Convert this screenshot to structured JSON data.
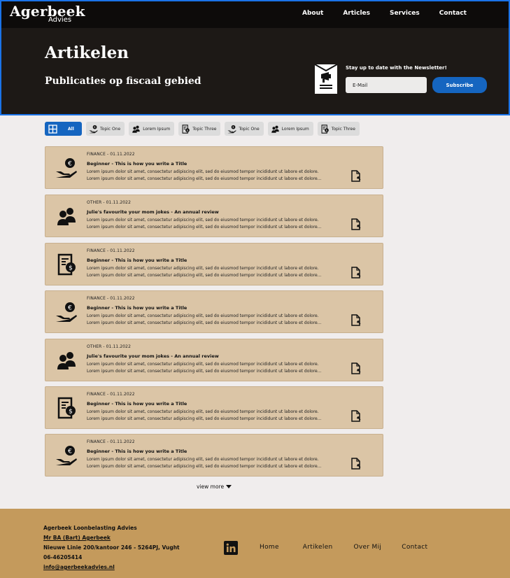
{
  "header": {
    "logo_main": "Agerbeek",
    "logo_sub": "Advies",
    "nav": [
      "About",
      "Articles",
      "Services",
      "Contact"
    ]
  },
  "hero": {
    "title": "Artikelen",
    "subtitle": "Publicaties op fiscaal gebied",
    "newsletter_label": "Stay up to date with the Newsletter!",
    "email_placeholder": "E-Mail",
    "subscribe_label": "Subscribe"
  },
  "filters": [
    {
      "label": "All",
      "icon": "grid-icon",
      "active": true
    },
    {
      "label": "Topic One",
      "icon": "coin-hand-icon",
      "active": false
    },
    {
      "label": "Lorem Ipsum",
      "icon": "people-icon",
      "active": false
    },
    {
      "label": "Topic Three",
      "icon": "invoice-icon",
      "active": false
    },
    {
      "label": "Topic One",
      "icon": "coin-hand-icon",
      "active": false
    },
    {
      "label": "Lorem Ipsum",
      "icon": "people-icon",
      "active": false
    },
    {
      "label": "Topic Three",
      "icon": "invoice-icon",
      "active": false
    }
  ],
  "articles": [
    {
      "meta": "FINANCE - 01.11.2022",
      "title": "Beginner - This is how you write a Title",
      "icon": "coin-hand-icon",
      "body1": "Lorem ipsum dolor sit amet, consectetur adipiscing elit, sed do eiusmod tempor incididunt ut labore et dolore.",
      "body2": "Lorem ipsum dolor sit amet, consectetur adipiscing elit, sed do eiusmod tempor incididunt ut labore et dolore..."
    },
    {
      "meta": "OTHER - 01.11.2022",
      "title": "Julie's favourite your mom jokes - An annual review",
      "icon": "people-icon",
      "body1": "Lorem ipsum dolor sit amet, consectetur adipiscing elit, sed do eiusmod tempor incididunt ut labore et dolore.",
      "body2": "Lorem ipsum dolor sit amet, consectetur adipiscing elit, sed do eiusmod tempor incididunt ut labore et dolore..."
    },
    {
      "meta": "FINANCE - 01.11.2022",
      "title": "Beginner - This is how you write a Title",
      "icon": "invoice-icon",
      "body1": "Lorem ipsum dolor sit amet, consectetur adipiscing elit, sed do eiusmod tempor incididunt ut labore et dolore.",
      "body2": "Lorem ipsum dolor sit amet, consectetur adipiscing elit, sed do eiusmod tempor incididunt ut labore et dolore..."
    },
    {
      "meta": "FINANCE - 01.11.2022",
      "title": "Beginner - This is how you write a Title",
      "icon": "coin-hand-icon",
      "body1": "Lorem ipsum dolor sit amet, consectetur adipiscing elit, sed do eiusmod tempor incididunt ut labore et dolore.",
      "body2": "Lorem ipsum dolor sit amet, consectetur adipiscing elit, sed do eiusmod tempor incididunt ut labore et dolore..."
    },
    {
      "meta": "OTHER - 01.11.2022",
      "title": "Julie's favourite your mom jokes - An annual review",
      "icon": "people-icon",
      "body1": "Lorem ipsum dolor sit amet, consectetur adipiscing elit, sed do eiusmod tempor incididunt ut labore et dolore.",
      "body2": "Lorem ipsum dolor sit amet, consectetur adipiscing elit, sed do eiusmod tempor incididunt ut labore et dolore..."
    },
    {
      "meta": "FINANCE - 01.11.2022",
      "title": "Beginner - This is how you write a Title",
      "icon": "invoice-icon",
      "body1": "Lorem ipsum dolor sit amet, consectetur adipiscing elit, sed do eiusmod tempor incididunt ut labore et dolore.",
      "body2": "Lorem ipsum dolor sit amet, consectetur adipiscing elit, sed do eiusmod tempor incididunt ut labore et dolore..."
    },
    {
      "meta": "FINANCE - 01.11.2022",
      "title": "Beginner - This is how you write a Title",
      "icon": "coin-hand-icon",
      "body1": "Lorem ipsum dolor sit amet, consectetur adipiscing elit, sed do eiusmod tempor incididunt ut labore et dolore.",
      "body2": "Lorem ipsum dolor sit amet, consectetur adipiscing elit, sed do eiusmod tempor incididunt ut labore et dolore..."
    }
  ],
  "view_more": "view more",
  "footer": {
    "company": "Agerbeek Loonbelasting Advies",
    "person": "Mr BA (Bart) Agerbeek",
    "address": "Nieuwe Linie 200/kantoor 246 - 5264PJ, Vught",
    "phone": "06-46205414",
    "email": "info@agerbeekadvies.nl",
    "nav": [
      "Home",
      "Artikelen",
      "Over Mij",
      "Contact"
    ]
  },
  "colors": {
    "header_bg": "#1d1916",
    "accent_blue": "#1565c0",
    "card_bg": "#dbc5a6",
    "footer_bg": "#c49a5c",
    "page_bg": "#f0eded"
  }
}
